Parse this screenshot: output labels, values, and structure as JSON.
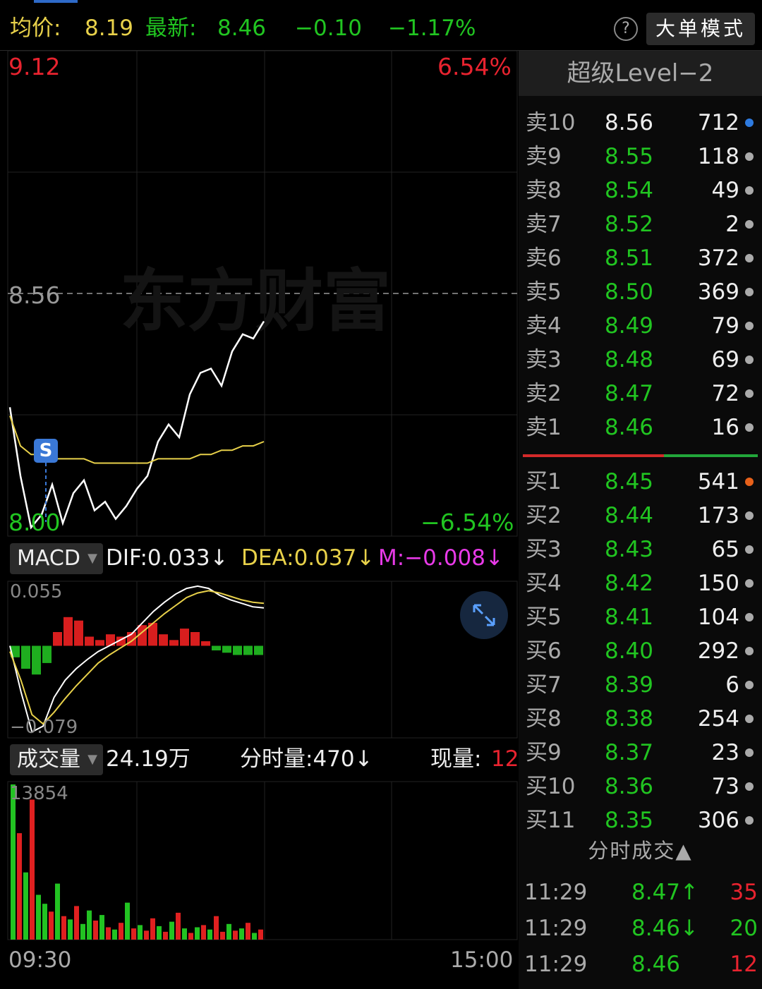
{
  "header": {
    "avg_label": "均价:",
    "avg_value": "8.19",
    "latest_label": "最新:",
    "latest_value": "8.46",
    "change": "−0.10",
    "change_pct": "−1.17%",
    "help": "?",
    "big_order_button": "大单模式"
  },
  "price_chart": {
    "high_price": "9.12",
    "high_pct": "6.54%",
    "mid_price": "8.56",
    "low_price": "8.00",
    "low_pct": "−6.54%",
    "watermark": "东方财富",
    "signal_marker": "S"
  },
  "macd": {
    "selector": "MACD",
    "dif": "DIF:0.033↓",
    "dea": "DEA:0.037↓",
    "m": "M:−0.008↓",
    "max_label": "0.055",
    "min_label": "−0.079"
  },
  "volume": {
    "selector": "成交量",
    "total": "24.19万",
    "minute_volume": "分时量:470↓",
    "current_label": "现量:",
    "current_value": "12",
    "max_label": "13854",
    "time_start": "09:30",
    "time_end": "15:00"
  },
  "order_book": {
    "title": "超级Level−2",
    "asks": [
      {
        "level": "卖10",
        "price": "8.56",
        "volume": "712",
        "dot": "#2e7be0"
      },
      {
        "level": "卖9",
        "price": "8.55",
        "volume": "118",
        "dot": "#aaaaaa"
      },
      {
        "level": "卖8",
        "price": "8.54",
        "volume": "49",
        "dot": "#aaaaaa"
      },
      {
        "level": "卖7",
        "price": "8.52",
        "volume": "2",
        "dot": "#aaaaaa"
      },
      {
        "level": "卖6",
        "price": "8.51",
        "volume": "372",
        "dot": "#aaaaaa"
      },
      {
        "level": "卖5",
        "price": "8.50",
        "volume": "369",
        "dot": "#aaaaaa"
      },
      {
        "level": "卖4",
        "price": "8.49",
        "volume": "79",
        "dot": "#aaaaaa"
      },
      {
        "level": "卖3",
        "price": "8.48",
        "volume": "69",
        "dot": "#aaaaaa"
      },
      {
        "level": "卖2",
        "price": "8.47",
        "volume": "72",
        "dot": "#aaaaaa"
      },
      {
        "level": "卖1",
        "price": "8.46",
        "volume": "16",
        "dot": "#aaaaaa"
      }
    ],
    "bids": [
      {
        "level": "买1",
        "price": "8.45",
        "volume": "541",
        "dot": "#e8611a"
      },
      {
        "level": "买2",
        "price": "8.44",
        "volume": "173",
        "dot": "#aaaaaa"
      },
      {
        "level": "买3",
        "price": "8.43",
        "volume": "65",
        "dot": "#aaaaaa"
      },
      {
        "level": "买4",
        "price": "8.42",
        "volume": "150",
        "dot": "#aaaaaa"
      },
      {
        "level": "买5",
        "price": "8.41",
        "volume": "104",
        "dot": "#aaaaaa"
      },
      {
        "level": "买6",
        "price": "8.40",
        "volume": "292",
        "dot": "#aaaaaa"
      },
      {
        "level": "买7",
        "price": "8.39",
        "volume": "6",
        "dot": "#aaaaaa"
      },
      {
        "level": "买8",
        "price": "8.38",
        "volume": "254",
        "dot": "#aaaaaa"
      },
      {
        "level": "买9",
        "price": "8.37",
        "volume": "23",
        "dot": "#aaaaaa"
      },
      {
        "level": "买10",
        "price": "8.36",
        "volume": "73",
        "dot": "#aaaaaa"
      },
      {
        "level": "买11",
        "price": "8.35",
        "volume": "306",
        "dot": "#aaaaaa"
      }
    ]
  },
  "trades": {
    "title": "分时成交▲",
    "rows": [
      {
        "time": "11:29",
        "price": "8.47↑",
        "volume": "35",
        "vol_color": "#e8232f"
      },
      {
        "time": "11:29",
        "price": "8.46↓",
        "volume": "20",
        "vol_color": "#21c521"
      },
      {
        "time": "11:29",
        "price": "8.46",
        "volume": "12",
        "vol_color": "#e8232f"
      }
    ]
  },
  "chart_data": [
    {
      "type": "line",
      "name": "intraday-price",
      "ylim": [
        8.0,
        9.12
      ],
      "prev_close": 8.56,
      "x": [
        "09:30",
        "15:00"
      ],
      "series": [
        {
          "color": "#ffffff",
          "values": [
            8.3,
            8.14,
            8.02,
            8.05,
            8.12,
            8.03,
            8.1,
            8.13,
            8.06,
            8.08,
            8.04,
            8.07,
            8.11,
            8.14,
            8.22,
            8.26,
            8.23,
            8.33,
            8.38,
            8.39,
            8.35,
            8.43,
            8.47,
            8.46,
            8.5
          ]
        },
        {
          "color": "#e8d14a",
          "values": [
            8.28,
            8.21,
            8.19,
            8.19,
            8.18,
            8.18,
            8.18,
            8.18,
            8.17,
            8.17,
            8.17,
            8.17,
            8.17,
            8.17,
            8.18,
            8.18,
            8.18,
            8.18,
            8.19,
            8.19,
            8.2,
            8.2,
            8.21,
            8.21,
            8.22
          ]
        }
      ]
    },
    {
      "type": "bar",
      "name": "macd",
      "ylim": [
        -0.079,
        0.055
      ],
      "dif": [
        -0.0,
        -0.04,
        -0.075,
        -0.07,
        -0.045,
        -0.03,
        -0.02,
        -0.012,
        -0.005,
        0.0,
        0.005,
        0.01,
        0.02,
        0.03,
        0.038,
        0.045,
        0.05,
        0.052,
        0.05,
        0.044,
        0.04,
        0.037,
        0.034,
        0.033
      ],
      "dea": [
        -0.005,
        -0.03,
        -0.06,
        -0.068,
        -0.058,
        -0.046,
        -0.035,
        -0.025,
        -0.015,
        -0.008,
        -0.002,
        0.004,
        0.012,
        0.02,
        0.028,
        0.035,
        0.042,
        0.046,
        0.048,
        0.046,
        0.043,
        0.04,
        0.038,
        0.037
      ],
      "m": [
        -0.01,
        -0.02,
        -0.025,
        -0.015,
        0.012,
        0.025,
        0.022,
        0.008,
        0.005,
        0.01,
        0.008,
        0.012,
        0.018,
        0.02,
        0.01,
        0.005,
        0.015,
        0.012,
        0.004,
        -0.004,
        -0.006,
        -0.008,
        -0.008,
        -0.008
      ]
    },
    {
      "type": "bar",
      "name": "volume",
      "ylim": [
        0,
        13854
      ],
      "values": [
        13854,
        9500,
        6000,
        12500,
        4000,
        3200,
        2500,
        5000,
        2100,
        1800,
        3000,
        1400,
        2600,
        1700,
        2200,
        1100,
        900,
        1500,
        3300,
        1000,
        1300,
        800,
        1900,
        1200,
        700,
        1600,
        2400,
        1000,
        600,
        1100,
        1300,
        900,
        2100,
        700,
        1400,
        800,
        1000,
        1500,
        600,
        900
      ],
      "colors": [
        "g",
        "r",
        "g",
        "r",
        "g",
        "g",
        "r",
        "g",
        "r",
        "g",
        "r",
        "g",
        "g",
        "r",
        "g",
        "r",
        "g",
        "r",
        "g",
        "r",
        "g",
        "r",
        "r",
        "g",
        "r",
        "g",
        "r",
        "g",
        "r",
        "g",
        "r",
        "g",
        "r",
        "r",
        "g",
        "r",
        "g",
        "r",
        "g",
        "r"
      ]
    }
  ]
}
